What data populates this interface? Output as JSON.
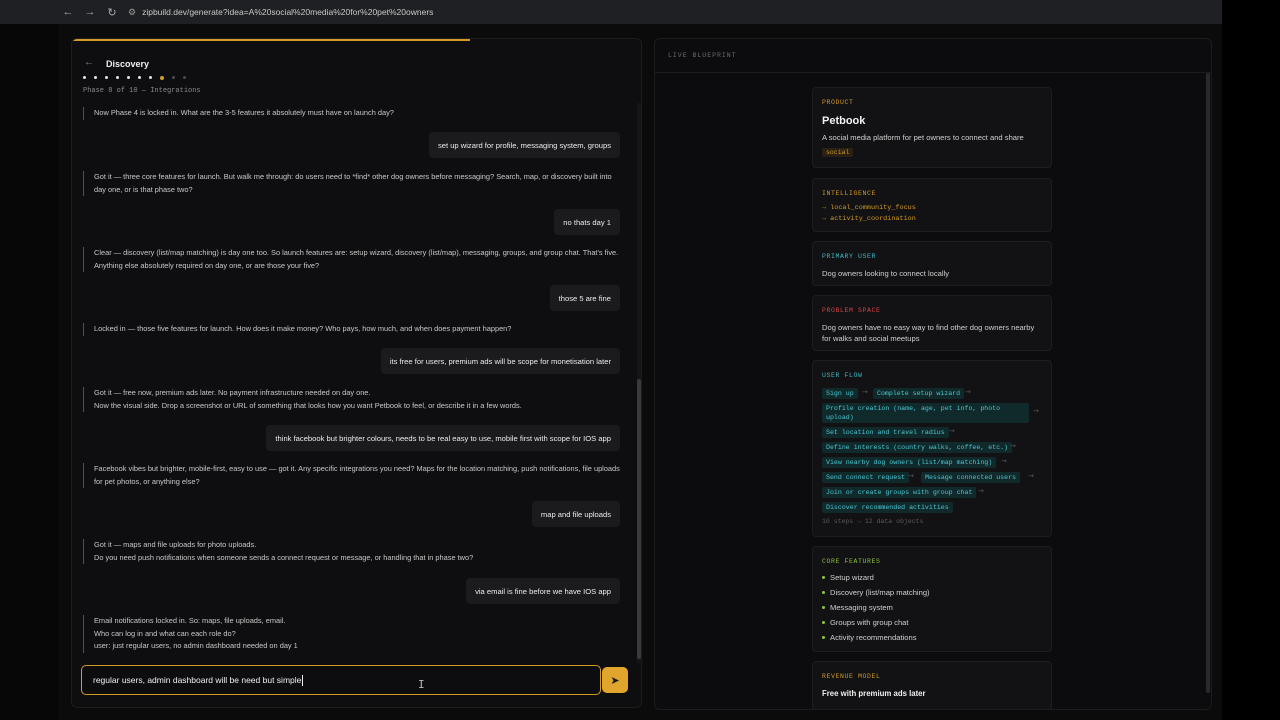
{
  "browser": {
    "back": "←",
    "forward": "→",
    "reload": "↻",
    "url": "zipbuild.dev/generate?idea=A%20social%20media%20for%20pet%20owners"
  },
  "chat": {
    "title": "Discovery",
    "phase": "Phase 8 of 10 — Integrations",
    "current_step": 8,
    "total_steps": 10,
    "messages": [
      {
        "role": "ai",
        "text": "Now Phase 4 is locked in. What are the 3-5 features it absolutely must have on launch day?"
      },
      {
        "role": "user",
        "text": "set up wizard for profile, messaging system, groups"
      },
      {
        "role": "ai",
        "text": "Got it — three core features for launch. But walk me through: do users need to *find* other dog owners before messaging? Search, map, or discovery built into day one, or is that phase two?"
      },
      {
        "role": "user",
        "text": "no thats day 1"
      },
      {
        "role": "ai",
        "text": "Clear — discovery (list/map matching) is day one too. So launch features are: setup wizard, discovery (list/map), messaging, groups, and group chat. That's five. Anything else absolutely required on day one, or are those your five?"
      },
      {
        "role": "user",
        "text": "those 5 are fine"
      },
      {
        "role": "ai",
        "text": "Locked in — those five features for launch. How does it make money? Who pays, how much, and when does payment happen?"
      },
      {
        "role": "user",
        "text": "its free for users, premium ads will be scope for monetisation later"
      },
      {
        "role": "ai",
        "text": "Got it — free now, premium ads later. No payment infrastructure needed on day one.\nNow the visual side. Drop a screenshot or URL of something that looks how you want Petbook to feel, or describe it in a few words."
      },
      {
        "role": "user",
        "text": "think facebook but brighter colours, needs to be real easy to use, mobile first with scope for IOS app"
      },
      {
        "role": "ai",
        "text": "Facebook vibes but brighter, mobile-first, easy to use — got it. Any specific integrations you need? Maps for the location matching, push notifications, file uploads for pet photos, or anything else?"
      },
      {
        "role": "user",
        "text": "map and file uploads"
      },
      {
        "role": "ai",
        "text": "Got it — maps and file uploads for photo uploads.\nDo you need push notifications when someone sends a connect request or message, or handling that in phase two?"
      },
      {
        "role": "user",
        "text": "via email is fine before we have IOS app"
      },
      {
        "role": "ai",
        "text": "Email notifications locked in. So: maps, file uploads, email.\nWho can log in and what can each role do?\nuser: just regular users, no admin dashboard needed on day 1"
      }
    ],
    "input_value": "regular users, admin dashboard will be need but simple",
    "send_icon": "send-icon"
  },
  "blueprint": {
    "title": "LIVE BLUEPRINT",
    "product": {
      "label": "PRODUCT",
      "name": "Petbook",
      "description": "A social media platform for pet owners to connect and share",
      "tag": "social"
    },
    "intelligence": {
      "label": "INTELLIGENCE",
      "items": [
        "→ local_community_focus",
        "→ activity_coordination"
      ]
    },
    "primary_user": {
      "label": "PRIMARY USER",
      "text": "Dog owners looking to connect locally"
    },
    "problem_space": {
      "label": "PROBLEM SPACE",
      "text": "Dog owners have no easy way to find other dog owners nearby for walks and social meetups"
    },
    "user_flow": {
      "label": "USER FLOW",
      "steps": [
        "Sign up",
        "Complete setup wizard",
        "Profile creation (name, age, pet info, photo upload)",
        "Set location and travel radius",
        "Define interests (country walks, coffee, etc.)",
        "View nearby dog owners (list/map matching)",
        "Send connect request",
        "Message connected users",
        "Join or create groups with group chat",
        "Discover recommended activities"
      ],
      "summary": "10 steps → 12 data objects"
    },
    "core_features": {
      "label": "CORE FEATURES",
      "items": [
        "Setup wizard",
        "Discovery (list/map matching)",
        "Messaging system",
        "Groups with group chat",
        "Activity recommendations"
      ]
    },
    "revenue_model": {
      "label": "REVENUE MODEL",
      "text": "Free with premium ads later"
    }
  },
  "colors": {
    "accent": "#d39a25",
    "teal": "#3fb8c7",
    "red": "#d64545",
    "green": "#8fc43c"
  }
}
